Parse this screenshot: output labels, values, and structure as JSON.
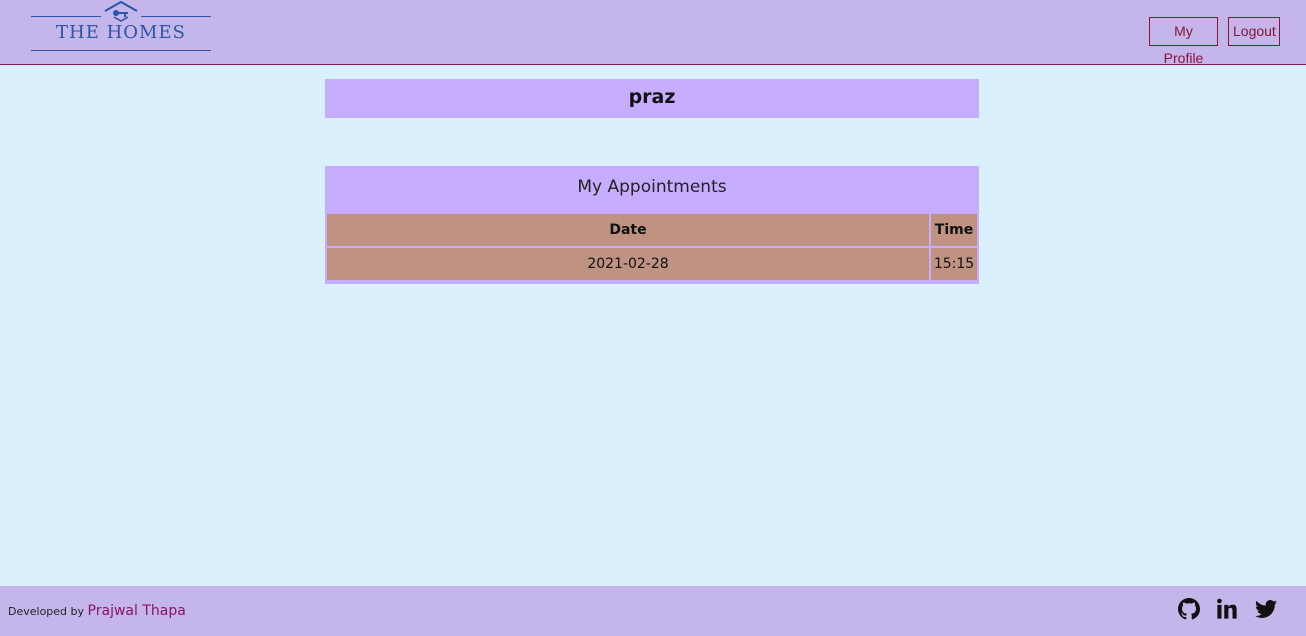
{
  "brand": {
    "name": "THE HOMES",
    "color": "#2a55a8"
  },
  "nav": {
    "profile_label": "My Profile",
    "logout_label": "Logout"
  },
  "user": {
    "name": "praz"
  },
  "appointments": {
    "title": "My Appointments",
    "columns": [
      "Date",
      "Time"
    ],
    "rows": [
      {
        "date": "2021-02-28",
        "time": "15:15"
      }
    ]
  },
  "footer": {
    "developed_by": "Developed by",
    "developer_name": "Prajwal Thapa",
    "social_icons": [
      "github-icon",
      "linkedin-icon",
      "twitter-icon"
    ]
  },
  "colors": {
    "page_bg": "#daf0fc",
    "navbar_bg": "#c4b5ea",
    "panel_bg": "#c6adff",
    "cell_bg": "#c09282",
    "accent": "#8a1535"
  }
}
